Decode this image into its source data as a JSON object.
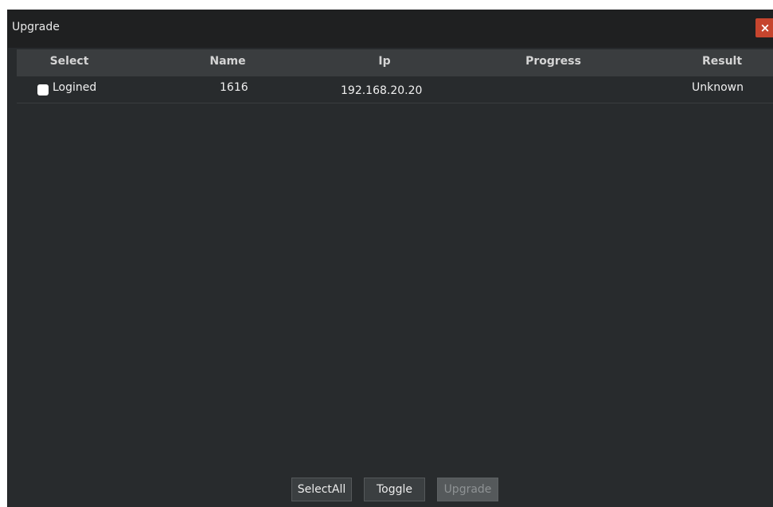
{
  "window": {
    "title": "Upgrade",
    "close_icon": "close-icon",
    "close_glyph": "×",
    "colors": {
      "background": "#282b2d",
      "titlebar": "#1f2021",
      "header": "#3a3d3f",
      "close_button": "#c6452e"
    }
  },
  "table": {
    "headers": {
      "select": "Select",
      "name": "Name",
      "ip": "Ip",
      "progress": "Progress",
      "result": "Result"
    },
    "rows": [
      {
        "checked": false,
        "select_label": "Logined",
        "name": "1616",
        "ip": "192.168.20.20",
        "progress": "",
        "result": "Unknown"
      }
    ]
  },
  "buttons": {
    "select_all": "SelectAll",
    "toggle": "Toggle",
    "upgrade": "Upgrade",
    "upgrade_disabled": true
  }
}
